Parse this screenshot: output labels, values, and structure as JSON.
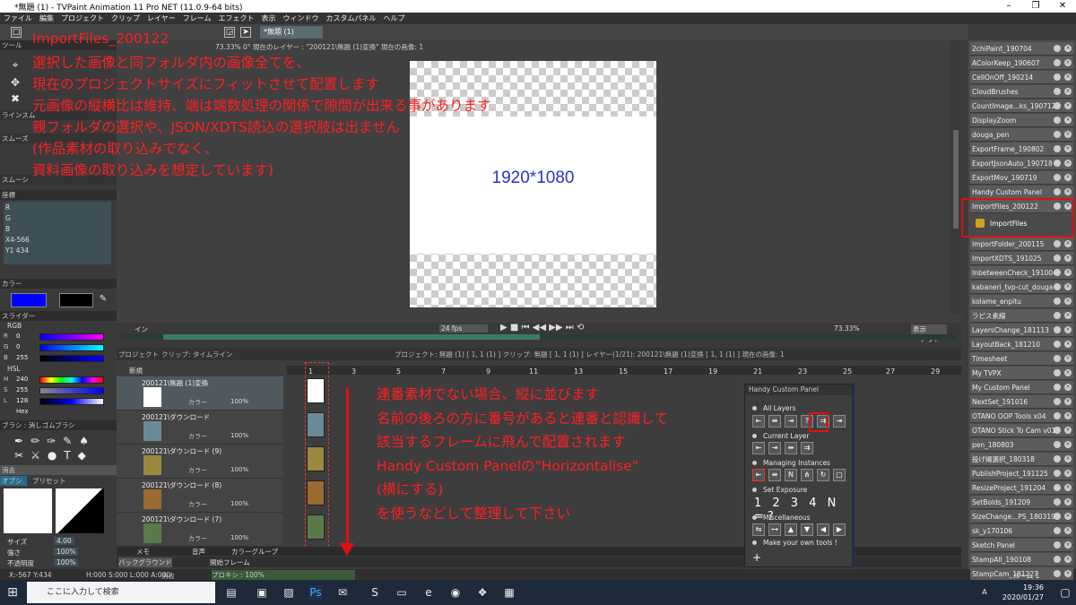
{
  "window": {
    "title": "*無題 (1) - TVPaint Animation 11 Pro NET (11.0.9-64 bits)"
  },
  "menu": [
    "ファイル",
    "編集",
    "プロジェクト",
    "クリップ",
    "レイヤー",
    "フレーム",
    "エフェクト",
    "表示",
    "ウィンドウ",
    "カスタムパネル",
    "ヘルプ"
  ],
  "toolbar": {
    "doc_tab": "*無題 (1)"
  },
  "canvas_status": "73.33%   0°   現在のレイヤー : \"200121\\無題 (1)変換\"  現在の画像: 1",
  "left": {
    "tool_label": "ツール",
    "line_label": "ラインスム",
    "smooth_label": "スムーズ",
    "stamp_label": "スムーシ",
    "coords_label": "座標",
    "rgb": [
      "R",
      "G",
      "B",
      "X4-566",
      "Y1 434"
    ],
    "color_label": "カラー",
    "slider_label": "スライダー",
    "rgb_mode": "RGB",
    "hsl_mode": "HSL",
    "sliders": [
      {
        "l": "R",
        "v": "0"
      },
      {
        "l": "G",
        "v": "0"
      },
      {
        "l": "B",
        "v": "255"
      },
      {
        "l": "H",
        "v": "240"
      },
      {
        "l": "S",
        "v": "255"
      },
      {
        "l": "L",
        "v": "128"
      },
      {
        "l": "",
        "v": "Hex"
      }
    ],
    "brush_label": "ブラシ : 消しゴムブラシ",
    "eraser": "消去",
    "option_tab": "オプション",
    "preset_tab": "プリセット",
    "size_label": "サイズ",
    "size_val": "4.00",
    "strength_label": "強さ",
    "strength_val": "100%",
    "opacity_label": "不透明度",
    "opacity_val": "100%"
  },
  "canvas": {
    "dims_text": "1920*1080"
  },
  "playbar": {
    "in_label": "イン",
    "out_label": "アウト",
    "fps": "24 fps",
    "zoom": "73.33%",
    "view_mode": "表示",
    "in_val": "1",
    "out_val": "1"
  },
  "infobar": {
    "tabs": [
      "プロジェクト",
      "クリップ: タイムライン"
    ],
    "text": "プロジェクト: 無題 (1) [ 1, 1 (1) ]     クリップ: 無題 [ 1, 1 (1) ]     レイヤー(1/21): 200121\\無題 (1)変換 [ 1, 1 (1) ]     現在の画像: 1"
  },
  "timeline": {
    "new_label": "新規",
    "frame_numbers": [
      "1",
      "3",
      "5",
      "7",
      "9",
      "11",
      "13",
      "15",
      "17",
      "19",
      "21",
      "23",
      "25",
      "27",
      "29"
    ],
    "layers": [
      {
        "name": "200121\\無題 (1)変換",
        "color_label": "カラー",
        "pct": "100%"
      },
      {
        "name": "200121\\ダウンロード",
        "color_label": "カラー",
        "pct": "100%"
      },
      {
        "name": "200121\\ダウンロード (9)",
        "color_label": "カラー",
        "pct": "100%"
      },
      {
        "name": "200121\\ダウンロード (8)",
        "color_label": "カラー",
        "pct": "100%"
      },
      {
        "name": "200121\\ダウンロード (7)",
        "color_label": "カラー",
        "pct": "100%"
      }
    ],
    "bottom_tabs": [
      "メモ",
      "音声",
      "カラーグループ"
    ],
    "background": "バックグラウンド",
    "start_frame": "開始フレーム"
  },
  "statusbar": {
    "coords": "X:-567  Y:434",
    "hsv": "H:000 S:000 L:000 A:000",
    "erase": "消去",
    "proxy": "プロキシ : 100%"
  },
  "taskbar": {
    "search": "ここに入力して検索",
    "time": "19:36",
    "date": "2020/01/27",
    "lang": "A"
  },
  "rightpanel": {
    "items": [
      "2chiPaint_190704",
      "AColorKeep_190607",
      "CellOnOff_190214",
      "CloudBrushes",
      "CountImage...ks_190712",
      "DisplayZoom",
      "douga_pen",
      "ExportFrame_190802",
      "ExportJsonAuto_190718",
      "ExportMov_190719",
      "Handy Custom Panel",
      "ImportFiles_200122",
      "ImportFolder_200115",
      "ImportXDTS_191025",
      "InbetweenCheck_191004",
      "kabaneri_tvp-cut_douga",
      "kolame_enpitu",
      "ラピス素線",
      "LayersChange_181113",
      "LayoutBack_181210",
      "Timesheet",
      "My TVPX",
      "My Custom Panel",
      "NextSet_191016",
      "OTANO OOP Tools x04",
      "OTANO Stick To Cam v01",
      "pen_180803",
      "投げ縄選択_180318",
      "PublishProject_191125",
      "ResizeProject_191204",
      "SetBolds_191209",
      "SizeChange...PS_180319",
      "sk_y170106",
      "Sketch Panel",
      "StampAll_190108",
      "StampCam_181227"
    ],
    "importfiles_button": "ImportFiles",
    "footer": "ルーム 1"
  },
  "hcp": {
    "title": "Handy Custom Panel",
    "all_layers": "All Layers",
    "current_layer": "Current Layer",
    "managing": "Managing Instances",
    "set_exposure": "Set Exposure",
    "exposure_nums": "1 2 3 4 N =?",
    "misc": "Miscellaneous",
    "make_tools": "Make your own tools !"
  },
  "annotations": {
    "top": [
      "ImportFiles_200122",
      "選択した画像と同フォルダ内の画像全てを、",
      "現在のプロジェクトサイズにフィットさせて配置します",
      "元画像の縦横比は維持、端は端数処理の関係で隙間が出来る事があります",
      "親フォルダの選択や、JSON/XDTS読込の選択肢は出ません",
      "(作品素材の取り込みでなく、",
      "資料画像の取り込みを想定しています)"
    ],
    "mid": [
      "連番素材でない場合、縦に並びます",
      "名前の後ろの方に番号があると連番と認識して",
      "該当するフレームに飛んで配置されます",
      "Handy Custom Panelの\"Horizontalise\"",
      "(横にする)",
      "を使うなどして整理して下さい"
    ]
  },
  "colors": {
    "annotation_red": "#ff2020",
    "dims_blue": "#2d2ed0",
    "fg_swatch": "#0000ff",
    "bg_swatch": "#000000"
  }
}
